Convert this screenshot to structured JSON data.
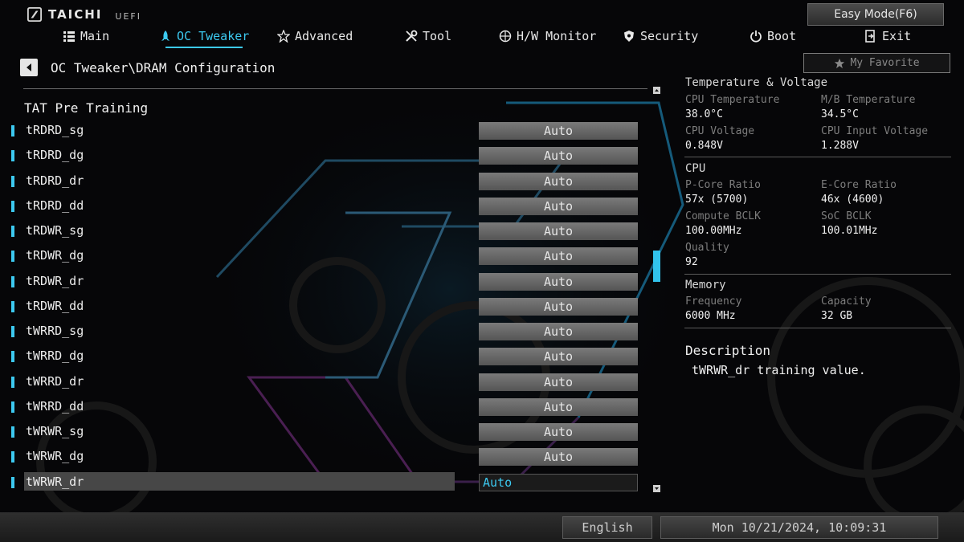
{
  "header": {
    "brand": "TAICHI",
    "sub_brand": "UEFI",
    "easy_mode_label": "Easy Mode(F6)",
    "favorite_label": "My Favorite"
  },
  "nav": {
    "items": [
      {
        "label": "Main",
        "icon": "list-icon",
        "active": false
      },
      {
        "label": "OC Tweaker",
        "icon": "rocket-icon",
        "active": true
      },
      {
        "label": "Advanced",
        "icon": "star-icon",
        "active": false
      },
      {
        "label": "Tool",
        "icon": "tools-icon",
        "active": false
      },
      {
        "label": "H/W Monitor",
        "icon": "target-icon",
        "active": false
      },
      {
        "label": "Security",
        "icon": "shield-icon",
        "active": false
      },
      {
        "label": "Boot",
        "icon": "power-icon",
        "active": false
      },
      {
        "label": "Exit",
        "icon": "exit-icon",
        "active": false
      }
    ]
  },
  "page": {
    "breadcrumb": "OC Tweaker\\DRAM Configuration",
    "section_title": "TAT Pre Training",
    "settings": [
      {
        "label": "tRDRD_sg",
        "value": "Auto"
      },
      {
        "label": "tRDRD_dg",
        "value": "Auto"
      },
      {
        "label": "tRDRD_dr",
        "value": "Auto"
      },
      {
        "label": "tRDRD_dd",
        "value": "Auto"
      },
      {
        "label": "tRDWR_sg",
        "value": "Auto"
      },
      {
        "label": "tRDWR_dg",
        "value": "Auto"
      },
      {
        "label": "tRDWR_dr",
        "value": "Auto"
      },
      {
        "label": "tRDWR_dd",
        "value": "Auto"
      },
      {
        "label": "tWRRD_sg",
        "value": "Auto"
      },
      {
        "label": "tWRRD_dg",
        "value": "Auto"
      },
      {
        "label": "tWRRD_dr",
        "value": "Auto"
      },
      {
        "label": "tWRRD_dd",
        "value": "Auto"
      },
      {
        "label": "tWRWR_sg",
        "value": "Auto"
      },
      {
        "label": "tWRWR_dg",
        "value": "Auto"
      },
      {
        "label": "tWRWR_dr",
        "value": "Auto",
        "selected": true
      }
    ]
  },
  "monitor": {
    "temp_voltage": {
      "title": "Temperature & Voltage",
      "cpu_temp_label": "CPU Temperature",
      "cpu_temp_value": "38.0°C",
      "mb_temp_label": "M/B Temperature",
      "mb_temp_value": "34.5°C",
      "cpu_voltage_label": "CPU Voltage",
      "cpu_voltage_value": "0.848V",
      "cpu_input_voltage_label": "CPU Input Voltage",
      "cpu_input_voltage_value": "1.288V"
    },
    "cpu": {
      "title": "CPU",
      "pcore_label": "P-Core Ratio",
      "pcore_value": "57x (5700)",
      "ecore_label": "E-Core Ratio",
      "ecore_value": "46x (4600)",
      "compute_bclk_label": "Compute BCLK",
      "compute_bclk_value": "100.00MHz",
      "soc_bclk_label": "SoC BCLK",
      "soc_bclk_value": "100.01MHz",
      "quality_label": "Quality",
      "quality_value": "92"
    },
    "memory": {
      "title": "Memory",
      "frequency_label": "Frequency",
      "frequency_value": "6000 MHz",
      "capacity_label": "Capacity",
      "capacity_value": "32 GB"
    }
  },
  "description": {
    "title": "Description",
    "text": "tWRWR_dr training value."
  },
  "footer": {
    "language": "English",
    "datetime": "Mon 10/21/2024, 10:09:31"
  },
  "colors": {
    "accent": "#3cc9f0",
    "background": "#060608",
    "value_box": "#6a6a6a"
  }
}
